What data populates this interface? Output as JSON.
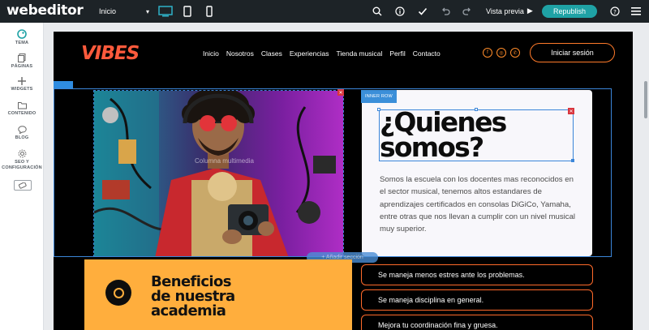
{
  "editor": {
    "logo_web": "web",
    "logo_editor": "editor",
    "page_select": "Inicio",
    "preview_label": "Vista previa",
    "republish_label": "Republish"
  },
  "sidebar": {
    "items": [
      {
        "label": "TEMA",
        "icon": "palette-icon"
      },
      {
        "label": "PÁGINAS",
        "icon": "pages-icon"
      },
      {
        "label": "WIDGETS",
        "icon": "plus-icon"
      },
      {
        "label": "CONTENIDO",
        "icon": "folder-icon"
      },
      {
        "label": "BLOG",
        "icon": "chat-icon"
      },
      {
        "label": "SEO Y CONFIGURACIÓN",
        "icon": "gear-icon"
      }
    ]
  },
  "site": {
    "logo": "VIBES",
    "nav": [
      "Inicio",
      "Nosotros",
      "Clases",
      "Experiencias",
      "Tienda musical",
      "Perfil",
      "Contacto"
    ],
    "login_label": "Iniciar sesión",
    "column_watermark": "Columna multimedia",
    "inner_row_tag": "INNER ROW",
    "heading_line1": "¿Quienes",
    "heading_line2": "somos?",
    "paragraph": "Somos la escuela con los docentes mas reconocidos en el sector musical, tenemos altos estandares de aprendizajes certificados en consolas DiGiCo, Yamaha, entre otras que nos llevan a cumplir con un nivel musical muy superior.",
    "add_section": "+ Añadir sección",
    "benefits_title_1": "Beneficios",
    "benefits_title_2": "de nuestra",
    "benefits_title_3": "academia",
    "benefits": [
      "Se maneja menos estres ante los problemas.",
      "Se maneja disciplina en general.",
      "Mejora tu coordinación fina y gruesa."
    ]
  },
  "colors": {
    "topbar": "#1d2327",
    "accent": "#1fa2a5",
    "orange": "#ff7a2a",
    "benefits_bg": "#ffae3d",
    "selection_blue": "#3b86d9"
  }
}
